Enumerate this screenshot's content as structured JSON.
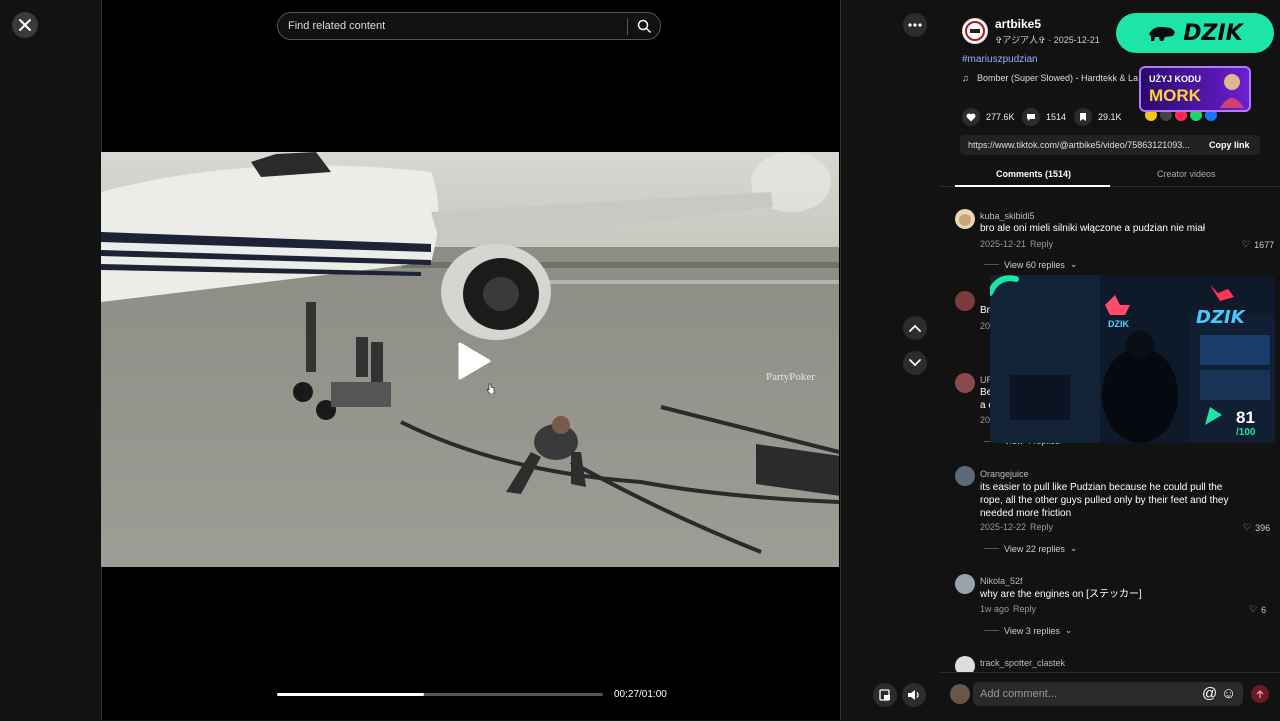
{
  "viewer": {
    "search_placeholder": "Find related content",
    "time": "00:27/01:00",
    "progress": 0.45
  },
  "post": {
    "username": "artbike5",
    "sub": "✞アジア人✞ · 2025-12-21",
    "hashtag": "#mariuszpudzian",
    "music": "Bomber (Super Slowed) - Hardtekk & La",
    "likes": "277.6K",
    "comments": "1514",
    "saves": "29.1K",
    "link": "https://www.tiktok.com/@artbike5/video/75863121093...",
    "copy_label": "Copy link"
  },
  "tabs": {
    "comments": "Comments (1514)",
    "creator": "Creator videos"
  },
  "comments": [
    {
      "user": "kuba_skibidi5",
      "text": "bro ale oni mieli silniki włączone a pudzian nie miał",
      "date": "2025-12-21",
      "reply": "Reply",
      "likes": "1677",
      "view_replies": "View 60 replies"
    },
    {
      "user": "",
      "text": "Br",
      "date": "20",
      "reply": "",
      "likes": "",
      "view_replies": ""
    },
    {
      "user": "UR",
      "text": "Be",
      "text2": "a c",
      "date": "20",
      "reply": "",
      "likes": "",
      "view_replies": "View 4 replies"
    },
    {
      "user": "Orangejuice",
      "text": "its easier to pull like Pudzian because he could pull the",
      "text2": "rope, all the other guys pulled only by their feet and they",
      "text3": "needed more friction",
      "date": "2025-12-22",
      "reply": "Reply",
      "likes": "396",
      "view_replies": "View 22 replies"
    },
    {
      "user": "Nikola_52f",
      "text": "why are the engines on [ステッカー]",
      "date": "1w ago",
      "reply": "Reply",
      "likes": "6",
      "view_replies": "View 3 replies"
    },
    {
      "user": "track_spotter_clastek",
      "text": "",
      "date": "",
      "reply": "",
      "likes": "",
      "view_replies": ""
    }
  ],
  "add_comment_placeholder": "Add comment...",
  "ads": {
    "brand": "DZIK",
    "promo_line1": "UŻYJ KODU",
    "promo_line2": "MORK",
    "stream_score": "81",
    "stream_total": "/100",
    "stream_sign": "DZIK"
  },
  "banner_text": "PartyPoker"
}
